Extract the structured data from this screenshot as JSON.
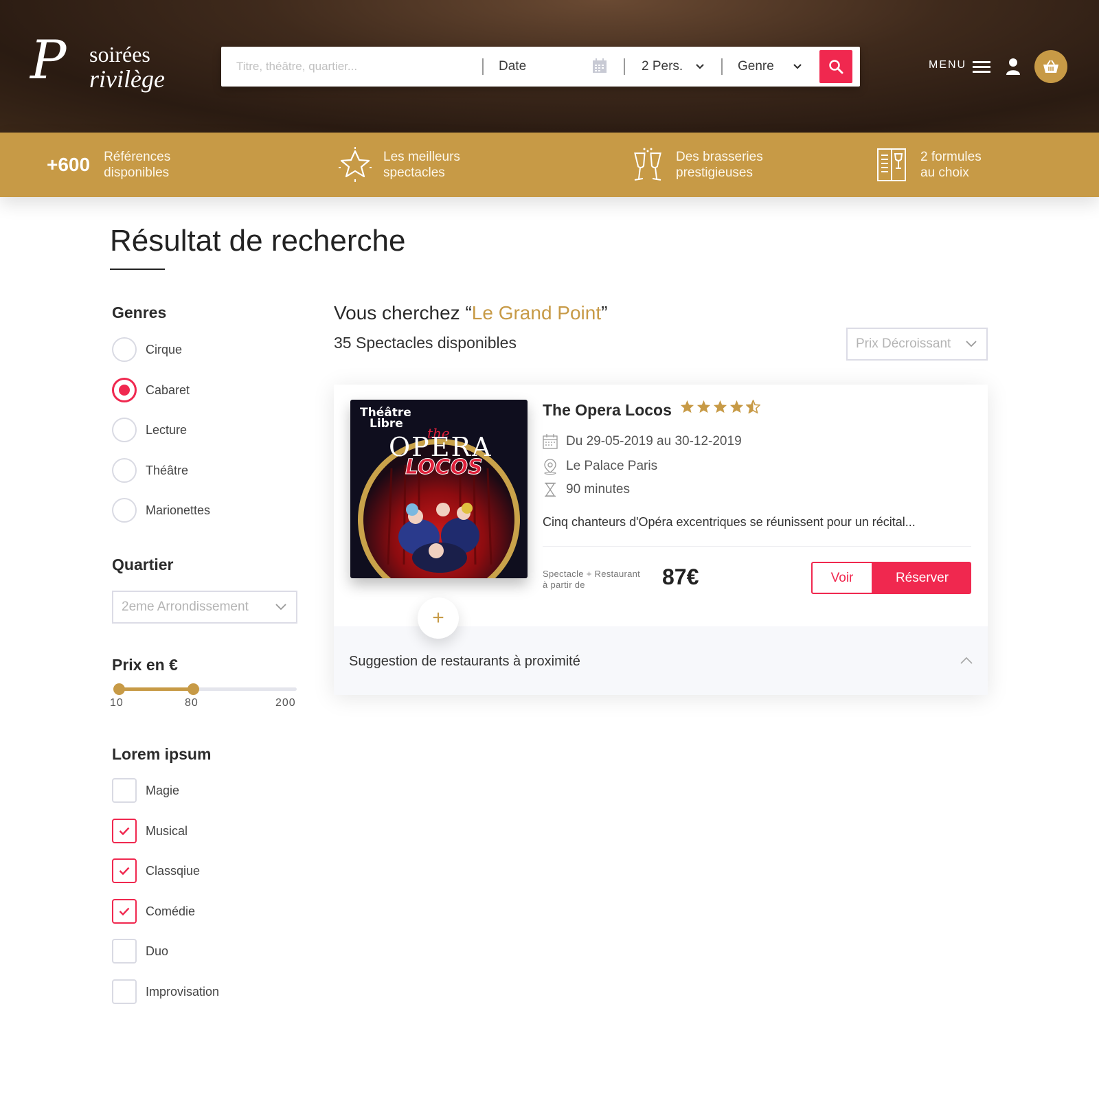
{
  "brand": {
    "logo_initial": "P",
    "logo_word1": "soirées",
    "logo_word2": "rivilège"
  },
  "search": {
    "placeholder": "Titre, théâtre, quartier...",
    "date_label": "Date",
    "persons_value": "2 Pers.",
    "genre_label": "Genre",
    "icons": [
      "calendar-icon",
      "chevron-down-icon",
      "search-icon"
    ]
  },
  "nav": {
    "menu_label": "MENU",
    "icons": [
      "hamburger-icon",
      "user-icon",
      "basket-icon"
    ]
  },
  "band": {
    "items": [
      {
        "number": "+600",
        "line1": "Références",
        "line2": "disponibles"
      },
      {
        "icon": "star-icon",
        "line1": "Les meilleurs",
        "line2": "spectacles"
      },
      {
        "icon": "champagne-glasses-icon",
        "line1": "Des brasseries",
        "line2": "prestigieuses"
      },
      {
        "icon": "menu-card-icon",
        "line1": "2 formules",
        "line2": "au choix"
      }
    ]
  },
  "page": {
    "title": "Résultat de recherche"
  },
  "filters": {
    "genres_heading": "Genres",
    "genres": [
      {
        "label": "Cirque",
        "selected": false
      },
      {
        "label": "Cabaret",
        "selected": true
      },
      {
        "label": "Lecture",
        "selected": false
      },
      {
        "label": "Théâtre",
        "selected": false
      },
      {
        "label": "Marionettes",
        "selected": false
      }
    ],
    "quartier_heading": "Quartier",
    "quartier_value": "2eme Arrondissement",
    "prix_heading": "Prix en €",
    "prix_min": "10",
    "prix_selected": "80",
    "prix_max": "200",
    "prix_range": [
      10,
      80
    ],
    "lorem_heading": "Lorem ipsum",
    "lorem_options": [
      {
        "label": "Magie",
        "checked": false
      },
      {
        "label": "Musical",
        "checked": true
      },
      {
        "label": "Classqiue",
        "checked": true
      },
      {
        "label": "Comédie",
        "checked": true
      },
      {
        "label": "Duo",
        "checked": false
      },
      {
        "label": "Improvisation",
        "checked": false
      }
    ]
  },
  "results": {
    "search_prefix": "Vous cherchez “",
    "search_term": "Le Grand Point",
    "search_suffix": "”",
    "count_text": "35 Spectacles disponibles",
    "sort_value": "Prix Décroissant"
  },
  "card": {
    "poster_top": "Théâtre",
    "poster_top2": "Libre",
    "poster_the": "the",
    "poster_title": "OPERA",
    "poster_sub": "LOCOS",
    "title": "The Opera Locos",
    "rating": 4.5,
    "dates": "Du 29-05-2019 au 30-12-2019",
    "venue": "Le Palace Paris",
    "duration": "90 minutes",
    "description": "Cinq chanteurs d'Opéra excentriques se réunissent pour un récital...",
    "price_caption_1": "Spectacle + Restaurant",
    "price_caption_2": "à partir de",
    "price": "87€",
    "btn_voir": "Voir",
    "btn_reserver": "Réserver",
    "plus_label": "+",
    "suggestion": "Suggestion de restaurants à proximité"
  },
  "colors": {
    "accent_red": "#f0284f",
    "gold": "#c79a46",
    "header_brown": "#3f2a1c"
  }
}
